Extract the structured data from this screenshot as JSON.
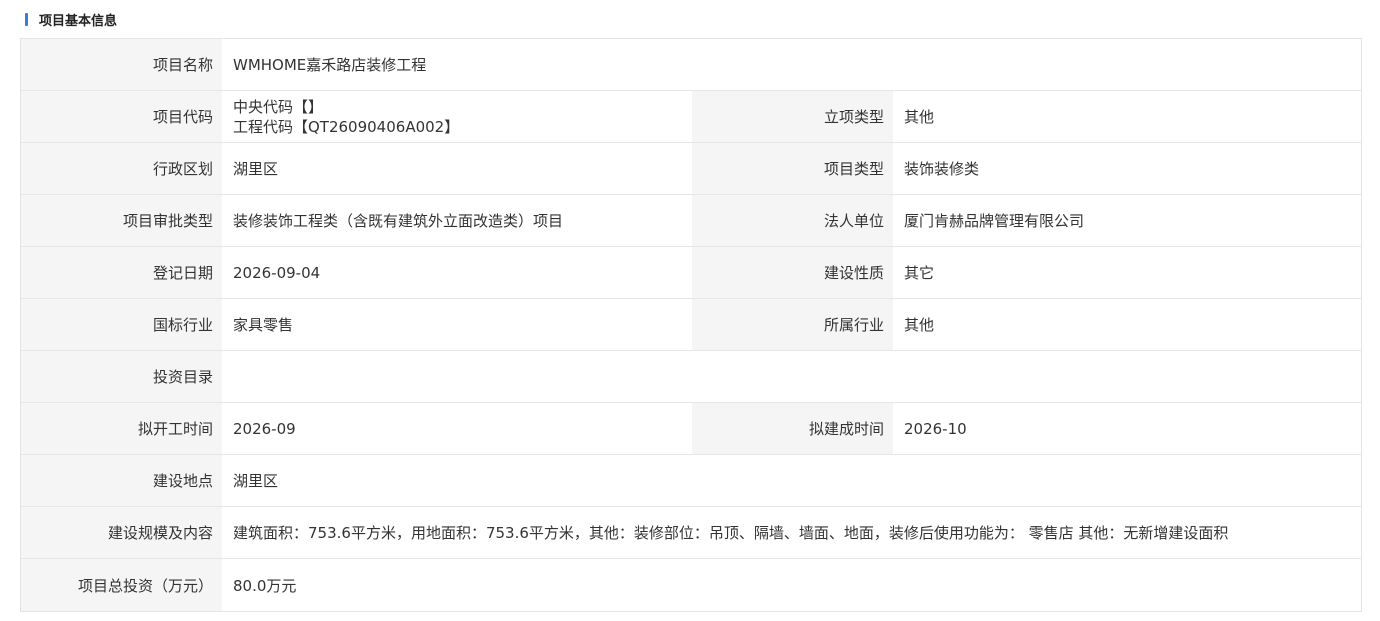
{
  "section": {
    "title": "项目基本信息",
    "accent_color": "#3b7be0"
  },
  "fields": {
    "project_name": {
      "label": "项目名称",
      "value": "WMHOME嘉禾路店装修工程"
    },
    "project_code": {
      "label": "项目代码",
      "lines": [
        "中央代码【】",
        "工程代码【QT26090406A002】"
      ]
    },
    "approval_type": {
      "label": "立项类型",
      "value": "其他"
    },
    "district": {
      "label": "行政区划",
      "value": "湖里区"
    },
    "project_type": {
      "label": "项目类型",
      "value": "装饰装修类"
    },
    "review_type": {
      "label": "项目审批类型",
      "value": "装修装饰工程类（含既有建筑外立面改造类）项目"
    },
    "legal_entity": {
      "label": "法人单位",
      "value": "厦门肯赫品牌管理有限公司"
    },
    "register_date": {
      "label": "登记日期",
      "value": "2026-09-04"
    },
    "build_nature": {
      "label": "建设性质",
      "value": "其它"
    },
    "national_industry": {
      "label": "国标行业",
      "value": "家具零售"
    },
    "industry": {
      "label": "所属行业",
      "value": "其他"
    },
    "investment_catalog": {
      "label": "投资目录",
      "value": ""
    },
    "planned_start": {
      "label": "拟开工时间",
      "value": "2026-09"
    },
    "planned_completion": {
      "label": "拟建成时间",
      "value": "2026-10"
    },
    "location": {
      "label": "建设地点",
      "value": "湖里区"
    },
    "scale_content": {
      "label": "建设规模及内容",
      "value": "建筑面积：753.6平方米，用地面积：753.6平方米，其他：装修部位：吊顶、隔墙、墙面、地面，装修后使用功能为： 零售店 其他：无新增建设面积"
    },
    "total_investment": {
      "label": "项目总投资（万元）",
      "value": "80.0万元"
    }
  }
}
